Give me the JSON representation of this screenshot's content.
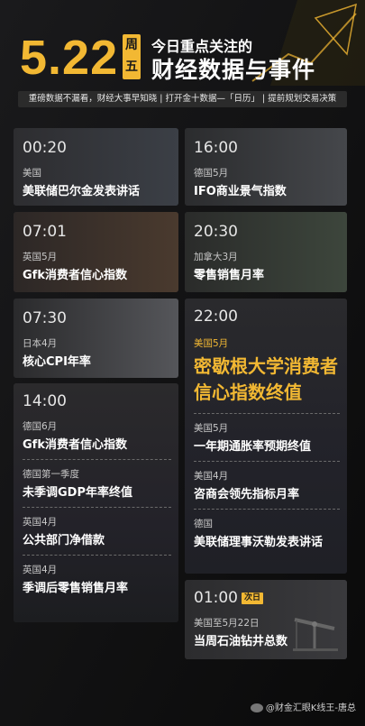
{
  "header": {
    "date": "5.22",
    "weekday": [
      "周",
      "五"
    ],
    "subtitle": "今日重点关注的",
    "title": "财经数据与事件",
    "tagline": "重磅数据不漏看，财经大事早知晓 | 打开金十数据—「日历」 | 提前规划交易决策"
  },
  "left_column": [
    {
      "time": "00:20",
      "events": [
        {
          "country": "美国",
          "title": "美联储巴尔金发表讲话"
        }
      ]
    },
    {
      "time": "07:01",
      "events": [
        {
          "country": "英国5月",
          "title": "Gfk消费者信心指数"
        }
      ]
    },
    {
      "time": "07:30",
      "events": [
        {
          "country": "日本4月",
          "title": "核心CPI年率"
        }
      ]
    },
    {
      "time": "14:00",
      "events": [
        {
          "country": "德国6月",
          "title": "Gfk消费者信心指数"
        },
        {
          "country": "德国第一季度",
          "title": "未季调GDP年率终值"
        },
        {
          "country": "英国4月",
          "title": "公共部门净借款"
        },
        {
          "country": "英国4月",
          "title": "季调后零售销售月率"
        }
      ]
    }
  ],
  "right_column": [
    {
      "time": "16:00",
      "events": [
        {
          "country": "德国5月",
          "title": "IFO商业景气指数"
        }
      ]
    },
    {
      "time": "20:30",
      "events": [
        {
          "country": "加拿大3月",
          "title": "零售销售月率"
        }
      ]
    },
    {
      "time": "22:00",
      "highlight": {
        "country": "美国5月",
        "title": "密歇根大学消费者信心指数终值"
      },
      "events": [
        {
          "country": "美国5月",
          "title": "一年期通胀率预期终值"
        },
        {
          "country": "美国4月",
          "title": "咨商会领先指标月率"
        },
        {
          "country": "德国",
          "title": "美联储理事沃勒发表讲话"
        }
      ]
    },
    {
      "time": "01:00",
      "badge": "次日",
      "events": [
        {
          "country": "美国至5月22日",
          "title": "当周石油钻井总数"
        }
      ]
    }
  ],
  "footer": {
    "text": "@财金汇眼K线王-唐总"
  },
  "colors": {
    "accent": "#f2b833",
    "background": "#0c0c0d",
    "card": "#232324"
  }
}
